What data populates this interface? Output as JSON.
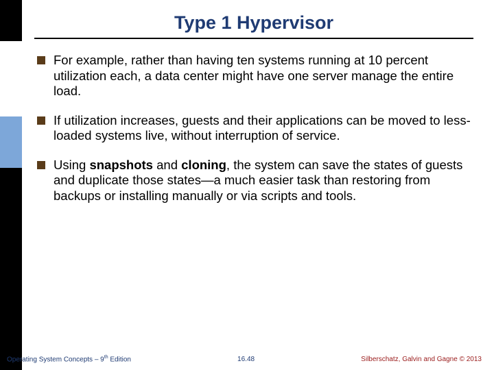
{
  "title": "Type 1 Hypervisor",
  "bullets": [
    {
      "pre": "For example, rather than having ten systems running at 10 percent utilization each, a data center might have one server manage the entire load."
    },
    {
      "pre": "If utilization increases, guests and their applications can be moved to less-loaded systems live, without interruption of service."
    },
    {
      "pre": "Using ",
      "b1": "snapshots",
      "mid": " and ",
      "b2": "cloning",
      "post": ", the system can save the states of guests and duplicate those states—a much easier task than restoring from backups or installing manually or via scripts and tools."
    }
  ],
  "footer": {
    "left_pre": "Operating System Concepts – 9",
    "left_sup": "th",
    "left_post": " Edition",
    "center": "16.48",
    "right": "Silberschatz, Galvin and Gagne © 2013"
  }
}
